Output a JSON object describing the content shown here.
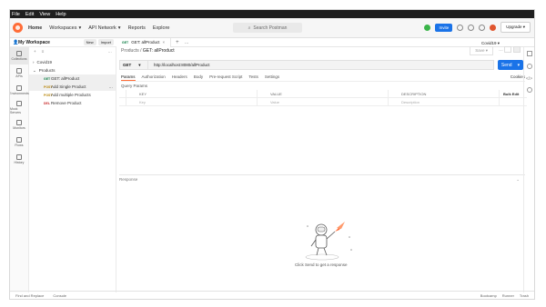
{
  "menu": [
    "File",
    "Edit",
    "View",
    "Help"
  ],
  "nav": {
    "home": "Home",
    "workspaces": "Workspaces",
    "api_network": "API Network",
    "reports": "Reports",
    "explore": "Explore"
  },
  "search": {
    "placeholder": "Search Postman"
  },
  "top": {
    "invite": "Invite",
    "upgrade": "Upgrade"
  },
  "workspace": {
    "title": "My Workspace",
    "new": "New",
    "import": "Import"
  },
  "leftnav": [
    "Collections",
    "APIs",
    "Environments",
    "Mock Servers",
    "Monitors",
    "Flows",
    "History"
  ],
  "tree": {
    "covid": "Covid19",
    "products": "Products",
    "items": [
      {
        "method": "GET",
        "label": "GET: allProduct"
      },
      {
        "method": "POST",
        "label": "Add Single Product"
      },
      {
        "method": "POST",
        "label": "Add multiple Products"
      },
      {
        "method": "DEL",
        "label": "Remove Product"
      }
    ]
  },
  "tab": {
    "label": "GET: allProduct",
    "environment": "Covid19"
  },
  "breadcrumb": {
    "parent": "Products",
    "current": "GET: allProduct",
    "save": "Save"
  },
  "request": {
    "method": "GET",
    "url": "http://localhost:8080/allProduct",
    "send": "Send"
  },
  "params_tabs": [
    "Params",
    "Authorization",
    "Headers",
    "Body",
    "Pre-request Script",
    "Tests",
    "Settings"
  ],
  "cookies": "Cookies",
  "query_params": "Query Params",
  "table": {
    "key": "KEY",
    "value": "VALUE",
    "description": "DESCRIPTION",
    "bulk_edit": "Bulk Edit",
    "key_ph": "Key",
    "value_ph": "Value",
    "desc_ph": "Description"
  },
  "response": {
    "label": "Response",
    "empty_text": "Click Send to get a response"
  },
  "status": {
    "find": "Find and Replace",
    "console": "Console",
    "bootcamp": "Bootcamp",
    "runner": "Runner",
    "trash": "Trash"
  }
}
